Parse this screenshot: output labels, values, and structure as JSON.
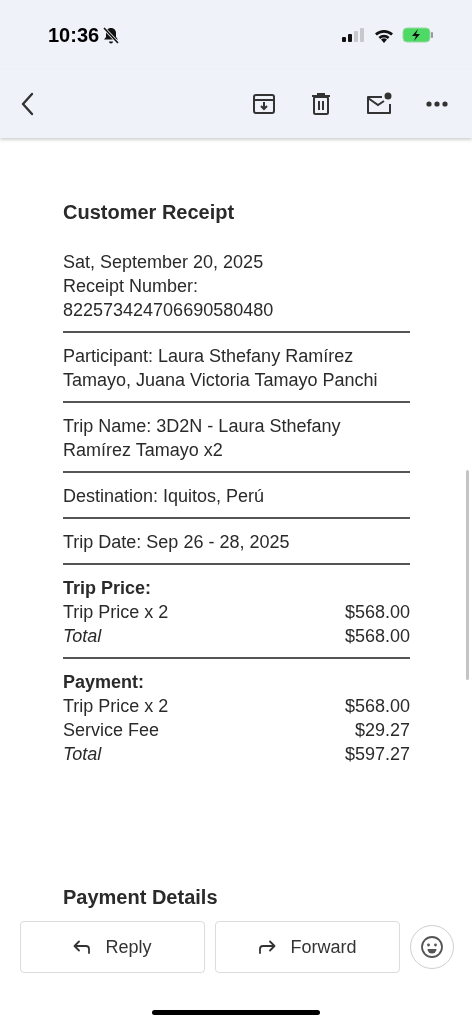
{
  "status_bar": {
    "time": "10:36"
  },
  "email": {
    "title": "Customer Receipt",
    "blocks": [
      {
        "kind": "text",
        "lines": [
          "Sat, September 20, 2025",
          "Receipt Number:",
          "822573424706690580480"
        ]
      },
      {
        "kind": "text",
        "lines": [
          "Participant: Laura Sthefany Ramírez Tamayo, Juana Victoria Tamayo Panchi"
        ]
      },
      {
        "kind": "text",
        "lines": [
          "Trip Name: 3D2N - Laura Sthefany Ramírez Tamayo x2"
        ]
      },
      {
        "kind": "text",
        "lines": [
          "Destination: Iquitos, Perú"
        ]
      },
      {
        "kind": "text",
        "lines": [
          "Trip Date: Sep 26 - 28, 2025"
        ]
      },
      {
        "kind": "prices",
        "heading": "Trip Price:",
        "rows": [
          {
            "kind": "item",
            "label": "Trip Price x 2",
            "amount": "$568.00"
          },
          {
            "kind": "total",
            "label": "Total",
            "amount": "$568.00"
          }
        ]
      },
      {
        "kind": "prices",
        "heading": "Payment:",
        "rows": [
          {
            "kind": "item",
            "label": "Trip Price x 2",
            "amount": "$568.00"
          },
          {
            "kind": "item",
            "label": "Service Fee",
            "amount": "$29.27"
          },
          {
            "kind": "total",
            "label": "Total",
            "amount": "$597.27"
          }
        ]
      }
    ],
    "next_heading": "Payment Details"
  },
  "actions": [
    {
      "kind": "reply",
      "label": "Reply"
    },
    {
      "kind": "forward",
      "label": "Forward"
    }
  ]
}
